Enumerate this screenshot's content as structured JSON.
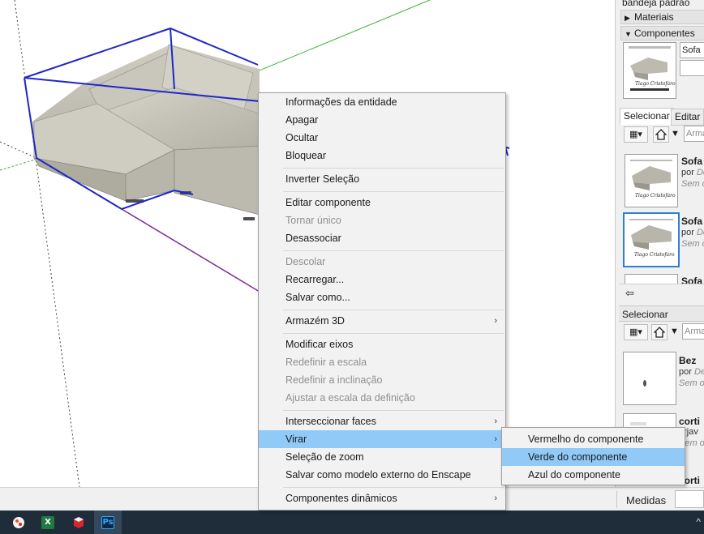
{
  "tray": {
    "top_cut_label": "bandeja padrão",
    "materials_header": "Materiais",
    "components_header": "Componentes",
    "component_name_value": "Sofa",
    "tabs": {
      "select": "Selecionar",
      "edit": "Editar"
    },
    "search_placeholder": "Arma",
    "results": [
      {
        "name": "Sofa",
        "author_prefix": "por",
        "author": "De",
        "status": "Sem o"
      },
      {
        "name": "Sofa",
        "author_prefix": "por",
        "author": "De",
        "status": "Sem o"
      },
      {
        "name": "Sofa"
      }
    ],
    "second_section": {
      "header": "Selecionar",
      "search_placeholder": "Arma",
      "results": [
        {
          "name": "Bez",
          "author_prefix": "por",
          "author": "De",
          "status": "Sem o"
        },
        {
          "name": "corti",
          "author_line": "orjav",
          "status": "Sem o"
        },
        {
          "name": "corti"
        }
      ]
    },
    "back_icon": "arrow-left-icon",
    "home_icon": "home-icon",
    "view_options_icon": "view-options-icon"
  },
  "status_bar": {
    "measure_label": "Medidas"
  },
  "context_menu": {
    "items": [
      {
        "label": "Informações da entidade"
      },
      {
        "label": "Apagar"
      },
      {
        "label": "Ocultar"
      },
      {
        "label": "Bloquear"
      },
      {
        "label": "Inverter Seleção"
      },
      {
        "label": "Editar componente"
      },
      {
        "label": "Tornar único"
      },
      {
        "label": "Desassociar"
      },
      {
        "label": "Descolar"
      },
      {
        "label": "Recarregar..."
      },
      {
        "label": "Salvar como..."
      },
      {
        "label": "Armazém 3D"
      },
      {
        "label": "Modificar eixos"
      },
      {
        "label": "Redefinir a escala"
      },
      {
        "label": "Redefinir a inclinação"
      },
      {
        "label": "Ajustar a escala da definição"
      },
      {
        "label": "Interseccionar faces"
      },
      {
        "label": "Virar"
      },
      {
        "label": "Seleção de zoom"
      },
      {
        "label": "Salvar como modelo externo do Enscape"
      },
      {
        "label": "Componentes dinâmicos"
      }
    ],
    "submenu_arrow": "›"
  },
  "submenu": {
    "items": [
      {
        "label": "Vermelho do componente"
      },
      {
        "label": "Verde do componente"
      },
      {
        "label": "Azul do componente"
      }
    ]
  },
  "taskbar": {
    "apps": [
      {
        "icon": "paint-app-icon"
      },
      {
        "icon": "excel-icon",
        "glyph": "X"
      },
      {
        "icon": "sketchup-icon"
      },
      {
        "icon": "photoshop-icon",
        "glyph": "Ps"
      }
    ],
    "tray_chevron": "^"
  },
  "colors": {
    "selection_box": "#1e28c8",
    "axis_green": "#3cb43c",
    "axis_purple": "#7a2a9a",
    "menu_highlight": "#91c9f7",
    "thumb_selected": "#2d7fd0"
  }
}
